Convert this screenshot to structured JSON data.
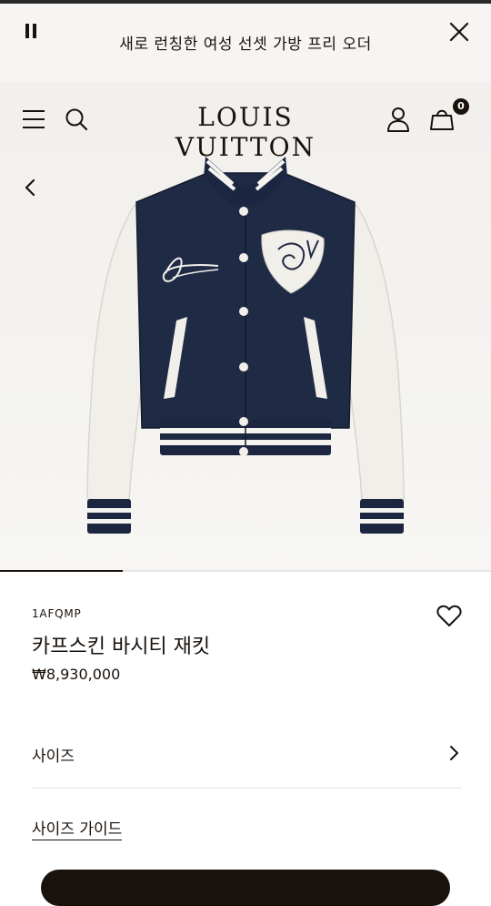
{
  "announcement": {
    "text": "새로 런칭한 여성 선셋 가방 프리 오더"
  },
  "header": {
    "brand": "LOUIS VUITTON",
    "cart_count": "0",
    "icons": [
      "menu-icon",
      "search-icon",
      "account-icon",
      "cart-icon"
    ]
  },
  "gallery": {
    "progress": 0.25,
    "previous_icon": "chevron-left-icon"
  },
  "product": {
    "sku": "1AFQMP",
    "name": "카프스킨 바시티 재킷",
    "price": "₩8,930,000",
    "wishlist_icon": "heart-icon",
    "embroidery_signature": "Louis Vuitton"
  },
  "options": {
    "size_label": "사이즈",
    "size_guide_label": "사이즈 가이드"
  },
  "colors": {
    "ink": "#19110b",
    "navy": "#1f2a44",
    "leather": "#f1efea"
  }
}
